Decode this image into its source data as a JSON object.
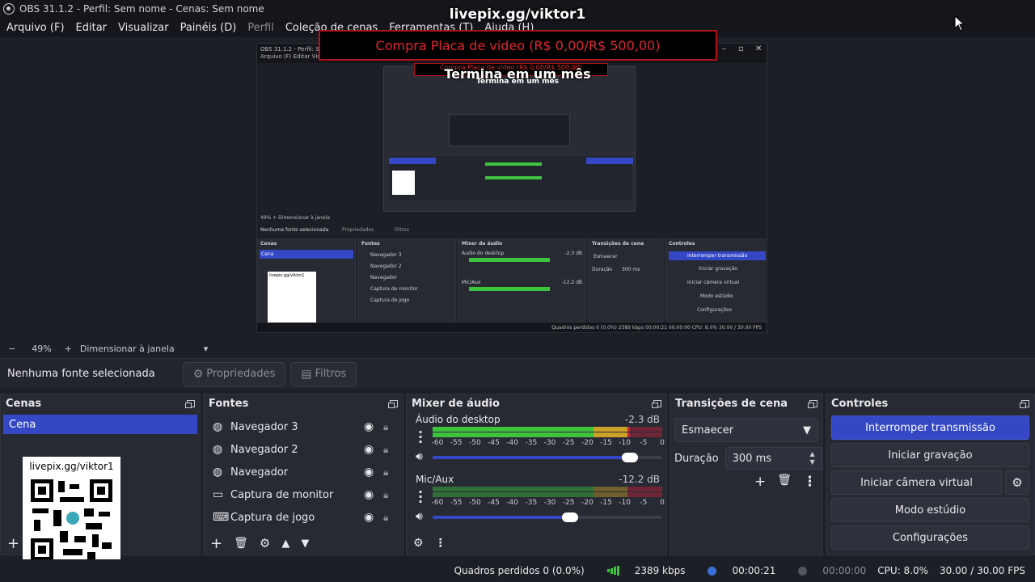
{
  "window": {
    "title": "OBS 31.1.2 - Perfil: Sem nome - Cenas: Sem nome"
  },
  "menu": [
    "Arquivo (F)",
    "Editar",
    "Visualizar",
    "Painéis (D)",
    "Perfil",
    "Coleção de cenas",
    "Ferramentas (T)",
    "Ajuda (H)"
  ],
  "overlay": {
    "livepix": "livepix.gg/viktor1",
    "goal": "Compra Placa de video (R$ 0,00/R$ 500,00)",
    "goal_sub": "Termina em um mês",
    "nested_goal": "Compra Placa de video (R$ 0,00/R$ 500,00)",
    "nested_sub": "Termina em um mês"
  },
  "nested": {
    "title": "OBS 31.1.2 - Perfil: Sem nome",
    "menu": "Arquivo (F)   Editar   Visualiz",
    "zoom": "49%   +   Dimensionar à janela",
    "source_none": "Nenhuma fonte selecionada",
    "props": "Propriedades",
    "filters": "Filtros",
    "cenas": "Cenas",
    "fontes": "Fontes",
    "mixer": "Mixer de áudio",
    "trans": "Transições de cena",
    "controles": "Controles",
    "scene": "Cena",
    "qr": "livepix.gg/viktor1",
    "sources": [
      "Navegador 3",
      "Navegador 2",
      "Navegador",
      "Captura de monitor",
      "Captura de jogo"
    ],
    "ch1": "Áudio do desktop",
    "ch1_db": "-2.3 dB",
    "ch2": "Mic/Aux",
    "ch2_db": "-12.2 dB",
    "fade": "Esmaecer",
    "duration": "Duração",
    "dur_val": "300 ms",
    "ctrl": [
      "Interromper transmissão",
      "Iniciar gravação",
      "Iniciar câmera virtual",
      "Modo estúdio",
      "Configurações"
    ],
    "status": "Quadros perdidos 0 (0.0%)   2389 kbps   00:00:21   00:00:00   CPU: 8.0%   30.00 / 30.00 FPS"
  },
  "zoom": {
    "minus": "−",
    "level": "49%",
    "plus": "+",
    "fit": "Dimensionar à janela",
    "arrow": "▾"
  },
  "source_bar": {
    "none_selected": "Nenhuma fonte selecionada",
    "properties": "Propriedades",
    "filters": "Filtros"
  },
  "scenes": {
    "title": "Cenas",
    "items": [
      "Cena"
    ],
    "qr_text": "livepix.gg/viktor1",
    "add": "+"
  },
  "sources": {
    "title": "Fontes",
    "items": [
      {
        "label": "Navegador 3",
        "icon": "browser-icon"
      },
      {
        "label": "Navegador 2",
        "icon": "browser-icon"
      },
      {
        "label": "Navegador",
        "icon": "browser-icon"
      },
      {
        "label": "Captura de monitor",
        "icon": "monitor-icon"
      },
      {
        "label": "Captura de jogo",
        "icon": "gamepad-icon"
      }
    ]
  },
  "mixer": {
    "title": "Mixer de áudio",
    "ticks": [
      "-60",
      "-55",
      "-50",
      "-45",
      "-40",
      "-35",
      "-30",
      "-25",
      "-20",
      "-15",
      "-10",
      "-5",
      "0"
    ],
    "channels": [
      {
        "name": "Áudio do desktop",
        "db": "-2.3 dB",
        "level": 0.86,
        "volume": 0.86
      },
      {
        "name": "Mic/Aux",
        "db": "-12.2 dB",
        "level": 0.0,
        "volume": 0.6
      }
    ]
  },
  "transitions": {
    "title": "Transições de cena",
    "selected": "Esmaecer",
    "duration_label": "Duração",
    "duration_value": "300 ms"
  },
  "controls": {
    "title": "Controles",
    "stop_stream": "Interromper transmissão",
    "start_record": "Iniciar gravação",
    "start_virtualcam": "Iniciar câmera virtual",
    "studio_mode": "Modo estúdio",
    "settings": "Configurações"
  },
  "status": {
    "dropped": "Quadros perdidos 0 (0.0%)",
    "bitrate": "2389 kbps",
    "stream_time": "00:00:21",
    "record_time": "00:00:00",
    "cpu": "CPU: 8.0%",
    "fps": "30.00 / 30.00 FPS"
  },
  "colors": {
    "accent": "#3447c5",
    "meter_green": "#3ec33e",
    "meter_yellow": "#c9a227",
    "meter_red": "#c8203a"
  }
}
